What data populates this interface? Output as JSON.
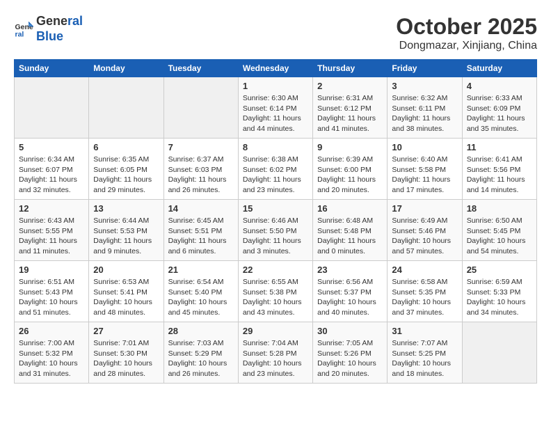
{
  "header": {
    "logo_line1": "General",
    "logo_line2": "Blue",
    "month_title": "October 2025",
    "location": "Dongmazar, Xinjiang, China"
  },
  "days_of_week": [
    "Sunday",
    "Monday",
    "Tuesday",
    "Wednesday",
    "Thursday",
    "Friday",
    "Saturday"
  ],
  "weeks": [
    [
      {
        "day": "",
        "info": ""
      },
      {
        "day": "",
        "info": ""
      },
      {
        "day": "",
        "info": ""
      },
      {
        "day": "1",
        "info": "Sunrise: 6:30 AM\nSunset: 6:14 PM\nDaylight: 11 hours and 44 minutes."
      },
      {
        "day": "2",
        "info": "Sunrise: 6:31 AM\nSunset: 6:12 PM\nDaylight: 11 hours and 41 minutes."
      },
      {
        "day": "3",
        "info": "Sunrise: 6:32 AM\nSunset: 6:11 PM\nDaylight: 11 hours and 38 minutes."
      },
      {
        "day": "4",
        "info": "Sunrise: 6:33 AM\nSunset: 6:09 PM\nDaylight: 11 hours and 35 minutes."
      }
    ],
    [
      {
        "day": "5",
        "info": "Sunrise: 6:34 AM\nSunset: 6:07 PM\nDaylight: 11 hours and 32 minutes."
      },
      {
        "day": "6",
        "info": "Sunrise: 6:35 AM\nSunset: 6:05 PM\nDaylight: 11 hours and 29 minutes."
      },
      {
        "day": "7",
        "info": "Sunrise: 6:37 AM\nSunset: 6:03 PM\nDaylight: 11 hours and 26 minutes."
      },
      {
        "day": "8",
        "info": "Sunrise: 6:38 AM\nSunset: 6:02 PM\nDaylight: 11 hours and 23 minutes."
      },
      {
        "day": "9",
        "info": "Sunrise: 6:39 AM\nSunset: 6:00 PM\nDaylight: 11 hours and 20 minutes."
      },
      {
        "day": "10",
        "info": "Sunrise: 6:40 AM\nSunset: 5:58 PM\nDaylight: 11 hours and 17 minutes."
      },
      {
        "day": "11",
        "info": "Sunrise: 6:41 AM\nSunset: 5:56 PM\nDaylight: 11 hours and 14 minutes."
      }
    ],
    [
      {
        "day": "12",
        "info": "Sunrise: 6:43 AM\nSunset: 5:55 PM\nDaylight: 11 hours and 11 minutes."
      },
      {
        "day": "13",
        "info": "Sunrise: 6:44 AM\nSunset: 5:53 PM\nDaylight: 11 hours and 9 minutes."
      },
      {
        "day": "14",
        "info": "Sunrise: 6:45 AM\nSunset: 5:51 PM\nDaylight: 11 hours and 6 minutes."
      },
      {
        "day": "15",
        "info": "Sunrise: 6:46 AM\nSunset: 5:50 PM\nDaylight: 11 hours and 3 minutes."
      },
      {
        "day": "16",
        "info": "Sunrise: 6:48 AM\nSunset: 5:48 PM\nDaylight: 11 hours and 0 minutes."
      },
      {
        "day": "17",
        "info": "Sunrise: 6:49 AM\nSunset: 5:46 PM\nDaylight: 10 hours and 57 minutes."
      },
      {
        "day": "18",
        "info": "Sunrise: 6:50 AM\nSunset: 5:45 PM\nDaylight: 10 hours and 54 minutes."
      }
    ],
    [
      {
        "day": "19",
        "info": "Sunrise: 6:51 AM\nSunset: 5:43 PM\nDaylight: 10 hours and 51 minutes."
      },
      {
        "day": "20",
        "info": "Sunrise: 6:53 AM\nSunset: 5:41 PM\nDaylight: 10 hours and 48 minutes."
      },
      {
        "day": "21",
        "info": "Sunrise: 6:54 AM\nSunset: 5:40 PM\nDaylight: 10 hours and 45 minutes."
      },
      {
        "day": "22",
        "info": "Sunrise: 6:55 AM\nSunset: 5:38 PM\nDaylight: 10 hours and 43 minutes."
      },
      {
        "day": "23",
        "info": "Sunrise: 6:56 AM\nSunset: 5:37 PM\nDaylight: 10 hours and 40 minutes."
      },
      {
        "day": "24",
        "info": "Sunrise: 6:58 AM\nSunset: 5:35 PM\nDaylight: 10 hours and 37 minutes."
      },
      {
        "day": "25",
        "info": "Sunrise: 6:59 AM\nSunset: 5:33 PM\nDaylight: 10 hours and 34 minutes."
      }
    ],
    [
      {
        "day": "26",
        "info": "Sunrise: 7:00 AM\nSunset: 5:32 PM\nDaylight: 10 hours and 31 minutes."
      },
      {
        "day": "27",
        "info": "Sunrise: 7:01 AM\nSunset: 5:30 PM\nDaylight: 10 hours and 28 minutes."
      },
      {
        "day": "28",
        "info": "Sunrise: 7:03 AM\nSunset: 5:29 PM\nDaylight: 10 hours and 26 minutes."
      },
      {
        "day": "29",
        "info": "Sunrise: 7:04 AM\nSunset: 5:28 PM\nDaylight: 10 hours and 23 minutes."
      },
      {
        "day": "30",
        "info": "Sunrise: 7:05 AM\nSunset: 5:26 PM\nDaylight: 10 hours and 20 minutes."
      },
      {
        "day": "31",
        "info": "Sunrise: 7:07 AM\nSunset: 5:25 PM\nDaylight: 10 hours and 18 minutes."
      },
      {
        "day": "",
        "info": ""
      }
    ]
  ]
}
